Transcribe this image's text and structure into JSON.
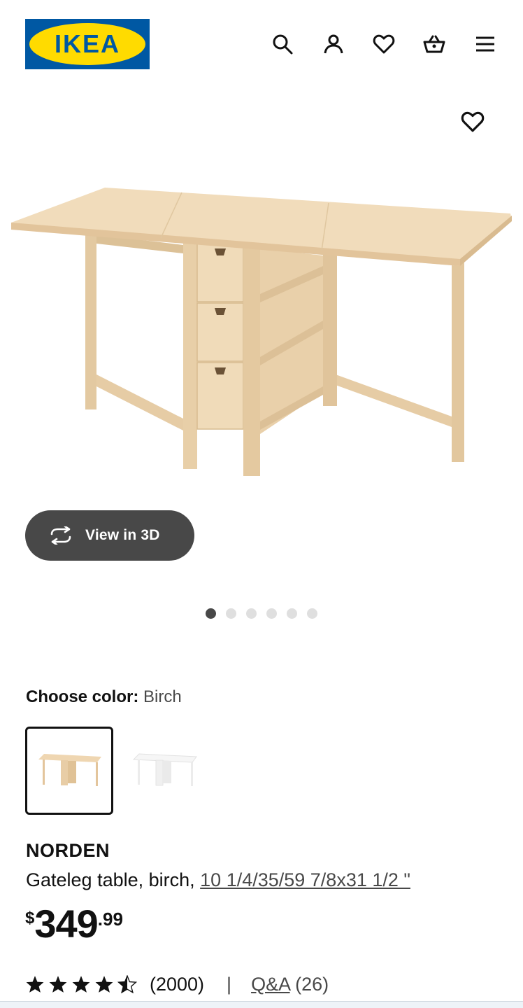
{
  "header": {
    "logo_text": "IKEA",
    "logo_colors": {
      "blue": "#0058a3",
      "yellow": "#ffdb00"
    },
    "icons": [
      "search-icon",
      "profile-icon",
      "heart-icon",
      "cart-icon",
      "menu-icon"
    ]
  },
  "gallery": {
    "favorite_icon": "heart-icon",
    "view3d_label": "View in 3D",
    "view3d_icon": "rotate-icon",
    "slide_count": 6,
    "active_slide": 1
  },
  "color": {
    "label": "Choose color:",
    "selected": "Birch",
    "options": [
      {
        "name": "Birch",
        "swatch": "#ead0ab",
        "selected": true
      },
      {
        "name": "White",
        "swatch": "#f4f4f4",
        "selected": false
      }
    ]
  },
  "product": {
    "name": "NORDEN",
    "description": "Gateleg table, birch, ",
    "dimensions": "10 1/4/35/59 7/8x31 1/2 \""
  },
  "price": {
    "currency": "$",
    "integer": "349",
    "decimal": ".99"
  },
  "rating": {
    "stars": 4.5,
    "count": "(2000)",
    "separator": "|",
    "qa_label": "Q&A",
    "qa_count": "(26)"
  }
}
